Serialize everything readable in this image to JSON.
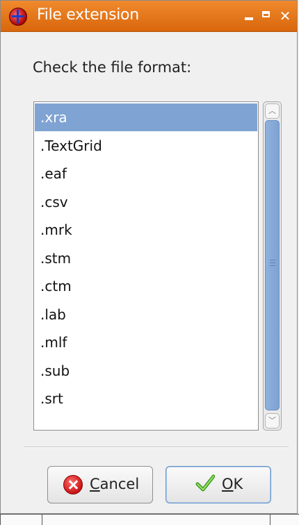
{
  "window": {
    "title": "File extension",
    "icon": "praat-app-icon",
    "controls": [
      "minimize-icon",
      "maximize-icon",
      "close-icon"
    ]
  },
  "prompt": "Check the file format:",
  "formats": {
    "selected_index": 0,
    "items": [
      ".xra",
      ".TextGrid",
      ".eaf",
      ".csv",
      ".mrk",
      ".stm",
      ".ctm",
      ".lab",
      ".mlf",
      ".sub",
      ".srt"
    ]
  },
  "buttons": {
    "cancel": {
      "mnemonic": "C",
      "rest": "ancel",
      "icon": "cancel-icon"
    },
    "ok": {
      "mnemonic": "O",
      "rest": "K",
      "icon": "checkmark-icon"
    }
  },
  "colors": {
    "titlebar": "#e87a1e",
    "selection": "#7fa3d3",
    "scroll_thumb": "#7ea2d3"
  }
}
